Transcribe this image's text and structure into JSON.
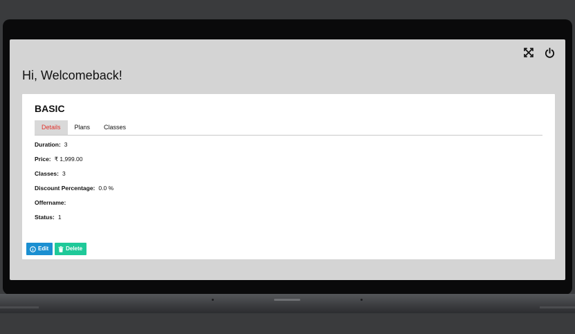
{
  "header": {
    "welcome": "Hi, Welcomeback!",
    "icons": [
      "fullscreen-icon",
      "power-icon"
    ]
  },
  "plan": {
    "title": "BASIC",
    "tabs": [
      {
        "label": "Details",
        "active": true
      },
      {
        "label": "Plans",
        "active": false
      },
      {
        "label": "Classes",
        "active": false
      }
    ],
    "fields": [
      {
        "label": "Duration:",
        "value": "3"
      },
      {
        "label": "Price:",
        "value": "₹ 1,999.00"
      },
      {
        "label": "Classes:",
        "value": "3"
      },
      {
        "label": "Discount Percentage:",
        "value": "0.0 %"
      },
      {
        "label": "Offername:",
        "value": ""
      },
      {
        "label": "Status:",
        "value": "1"
      }
    ],
    "actions": {
      "edit_label": "Edit",
      "delete_label": "Delete"
    }
  },
  "colors": {
    "active_tab_text": "#e0302a",
    "edit_button": "#1b8fd1",
    "delete_button": "#1fc999"
  }
}
